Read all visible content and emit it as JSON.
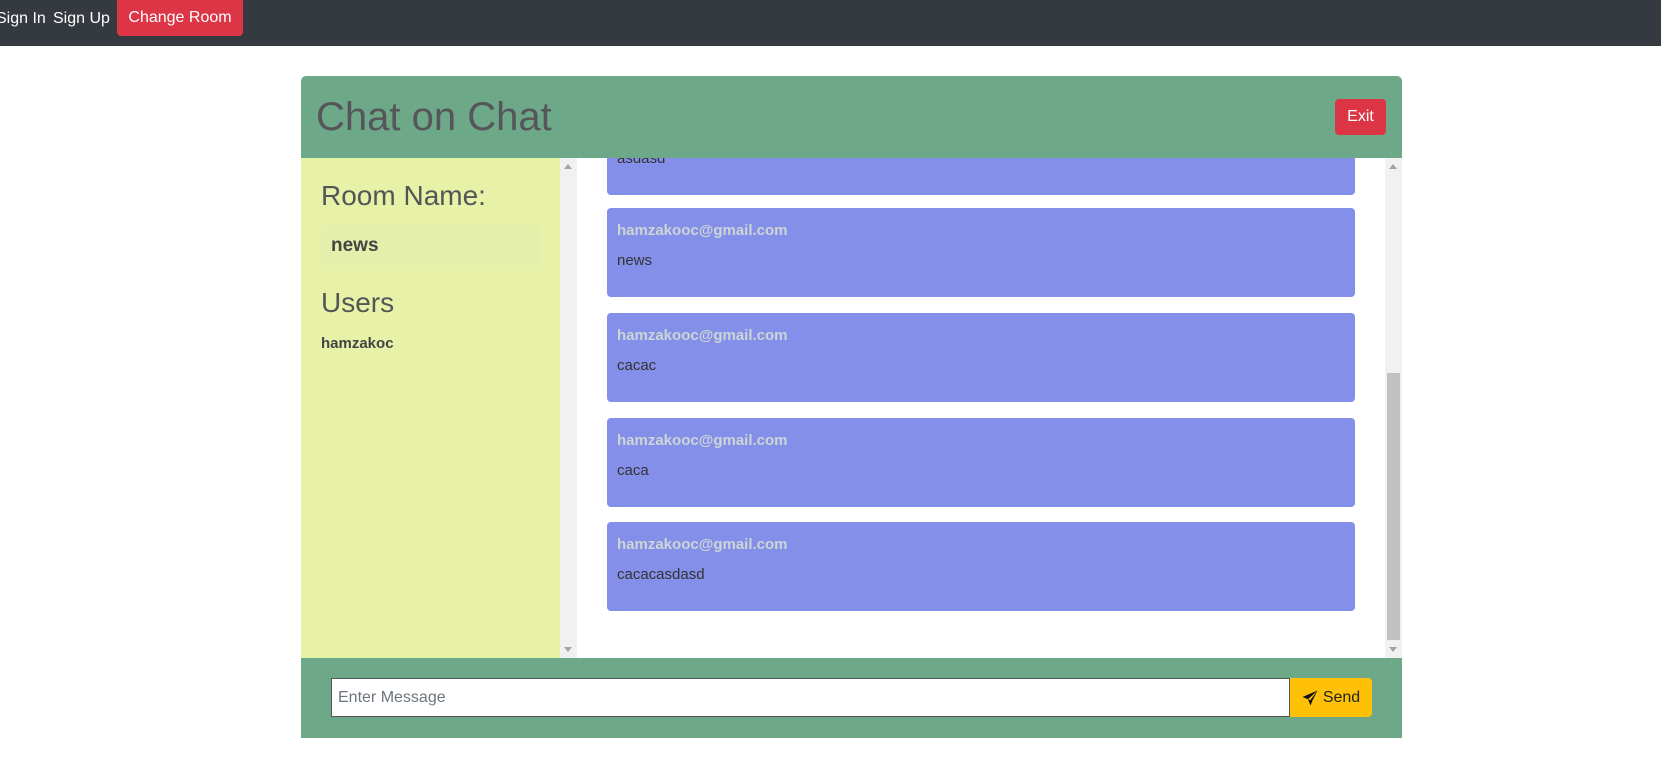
{
  "navbar": {
    "sign_in": "Sign In",
    "sign_up": "Sign Up",
    "change_room": "Change Room"
  },
  "header": {
    "title": "Chat on Chat",
    "exit_label": "Exit"
  },
  "sidebar": {
    "room_heading": "Room Name:",
    "room_name": "news",
    "users_heading": "Users",
    "users": [
      "hamzakoc"
    ]
  },
  "messages": [
    {
      "sender": "",
      "text": "asdasd"
    },
    {
      "sender": "hamzakooc@gmail.com",
      "text": "news"
    },
    {
      "sender": "hamzakooc@gmail.com",
      "text": "cacac"
    },
    {
      "sender": "hamzakooc@gmail.com",
      "text": "caca"
    },
    {
      "sender": "hamzakooc@gmail.com",
      "text": "cacacasdasd"
    }
  ],
  "footer": {
    "input_placeholder": "Enter Message",
    "input_value": "",
    "send_label": "Send"
  },
  "colors": {
    "navbar": "#343a40",
    "danger": "#dc3545",
    "card_green": "#6da889",
    "sidebar_yellow": "#e7f2a8",
    "message_blue": "#838fe8",
    "send_yellow": "#ffc107"
  },
  "icons": {
    "send": "paper-plane-icon"
  }
}
